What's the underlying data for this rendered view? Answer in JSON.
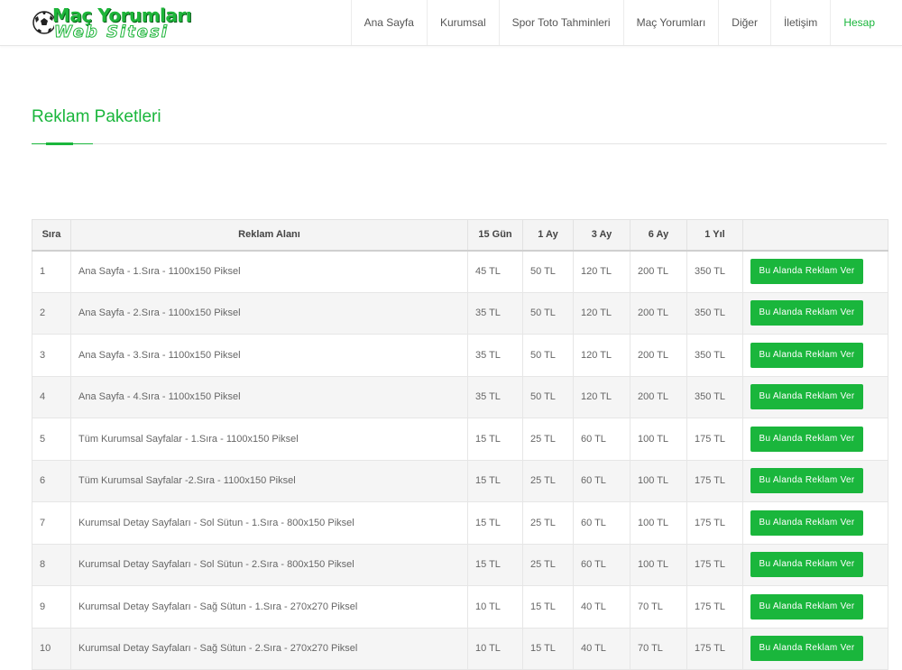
{
  "logo": {
    "line1": "Maç Yorumları",
    "line2": "Web Sitesi"
  },
  "nav": [
    {
      "label": "Ana Sayfa"
    },
    {
      "label": "Kurumsal"
    },
    {
      "label": "Spor Toto Tahminleri"
    },
    {
      "label": "Maç Yorumları"
    },
    {
      "label": "Diğer"
    },
    {
      "label": "İletişim"
    },
    {
      "label": "Hesap"
    }
  ],
  "accent_color": "#1ab63c",
  "page": {
    "title": "Reklam Paketleri"
  },
  "table": {
    "headers": [
      "Sıra",
      "Reklam Alanı",
      "15 Gün",
      "1 Ay",
      "3 Ay",
      "6 Ay",
      "1 Yıl",
      ""
    ],
    "button_label": "Bu Alanda Reklam Ver",
    "rows": [
      {
        "no": "1",
        "area": "Ana Sayfa - 1.Sıra - 1100x150 Piksel",
        "d15": "45 TL",
        "m1": "50 TL",
        "m3": "120 TL",
        "m6": "200 TL",
        "y1": "350 TL"
      },
      {
        "no": "2",
        "area": "Ana Sayfa - 2.Sıra - 1100x150 Piksel",
        "d15": "35 TL",
        "m1": "50 TL",
        "m3": "120 TL",
        "m6": "200 TL",
        "y1": "350 TL"
      },
      {
        "no": "3",
        "area": "Ana Sayfa - 3.Sıra - 1100x150 Piksel",
        "d15": "35 TL",
        "m1": "50 TL",
        "m3": "120 TL",
        "m6": "200 TL",
        "y1": "350 TL"
      },
      {
        "no": "4",
        "area": "Ana Sayfa - 4.Sıra - 1100x150 Piksel",
        "d15": "35 TL",
        "m1": "50 TL",
        "m3": "120 TL",
        "m6": "200 TL",
        "y1": "350 TL"
      },
      {
        "no": "5",
        "area": "Tüm Kurumsal Sayfalar - 1.Sıra - 1100x150 Piksel",
        "d15": "15 TL",
        "m1": "25 TL",
        "m3": "60 TL",
        "m6": "100 TL",
        "y1": "175 TL"
      },
      {
        "no": "6",
        "area": "Tüm Kurumsal Sayfalar -2.Sıra - 1100x150 Piksel",
        "d15": "15 TL",
        "m1": "25 TL",
        "m3": "60 TL",
        "m6": "100 TL",
        "y1": "175 TL"
      },
      {
        "no": "7",
        "area": "Kurumsal Detay Sayfaları - Sol Sütun - 1.Sıra - 800x150 Piksel",
        "d15": "15 TL",
        "m1": "25 TL",
        "m3": "60 TL",
        "m6": "100 TL",
        "y1": "175 TL"
      },
      {
        "no": "8",
        "area": "Kurumsal Detay Sayfaları - Sol Sütun - 2.Sıra - 800x150 Piksel",
        "d15": "15 TL",
        "m1": "25 TL",
        "m3": "60 TL",
        "m6": "100 TL",
        "y1": "175 TL"
      },
      {
        "no": "9",
        "area": "Kurumsal Detay Sayfaları - Sağ Sütun - 1.Sıra - 270x270 Piksel",
        "d15": "10 TL",
        "m1": "15 TL",
        "m3": "40 TL",
        "m6": "70 TL",
        "y1": "175 TL"
      },
      {
        "no": "10",
        "area": "Kurumsal Detay Sayfaları - Sağ Sütun - 2.Sıra - 270x270 Piksel",
        "d15": "10 TL",
        "m1": "15 TL",
        "m3": "40 TL",
        "m6": "70 TL",
        "y1": "175 TL"
      }
    ]
  }
}
